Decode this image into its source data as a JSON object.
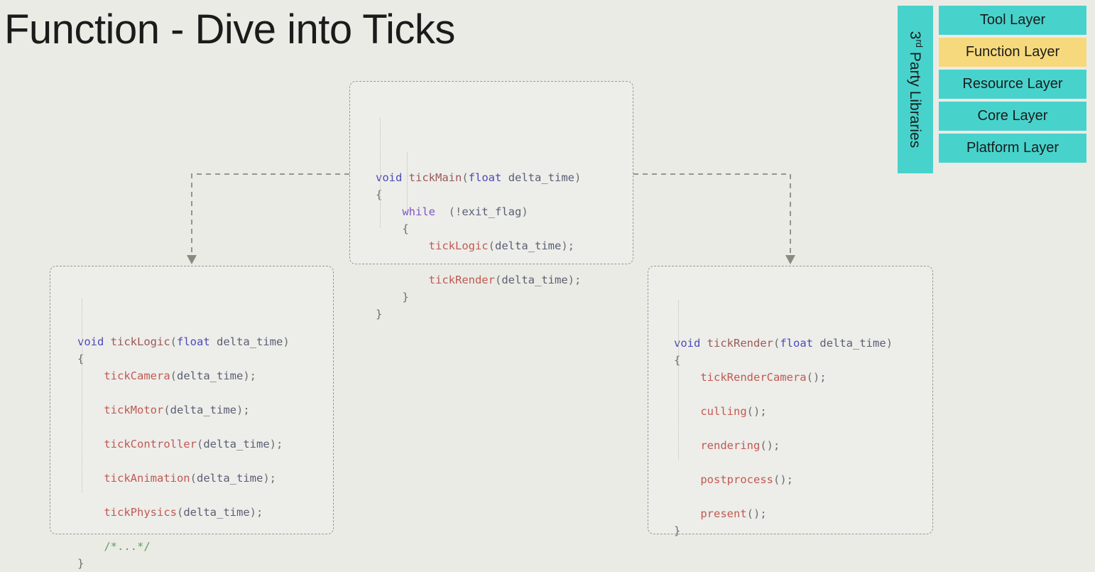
{
  "slide": {
    "title": "Function - Dive into Ticks",
    "background_color": "#ebebe6"
  },
  "layer_panel": {
    "third_party_label_main": "3",
    "third_party_label_sup": "rd",
    "third_party_label_rest": " Party Libraries",
    "teal_color": "#47d3cc",
    "highlight_color": "#f6d97c",
    "layers": [
      {
        "label": "Tool Layer",
        "highlighted": false
      },
      {
        "label": "Function Layer",
        "highlighted": true
      },
      {
        "label": "Resource Layer",
        "highlighted": false
      },
      {
        "label": "Core Layer",
        "highlighted": false
      },
      {
        "label": "Platform Layer",
        "highlighted": false
      }
    ]
  },
  "code_blocks": {
    "main": {
      "name": "tickMain",
      "signature_keyword": "void",
      "signature_name": "tickMain",
      "param_type": "float",
      "param_name": "delta_time",
      "lines": [
        {
          "tokens": [
            {
              "t": "kw",
              "v": "void"
            },
            {
              "t": "plain",
              "v": " "
            },
            {
              "t": "fndef",
              "v": "tickMain"
            },
            {
              "t": "punct",
              "v": "("
            },
            {
              "t": "kw",
              "v": "float"
            },
            {
              "t": "plain",
              "v": " "
            },
            {
              "t": "var",
              "v": "delta_time"
            },
            {
              "t": "punct",
              "v": ")"
            }
          ]
        },
        {
          "tokens": [
            {
              "t": "punct",
              "v": "{"
            }
          ]
        },
        {
          "tokens": [
            {
              "t": "plain",
              "v": "    "
            },
            {
              "t": "ctrl",
              "v": "while"
            },
            {
              "t": "plain",
              "v": "  "
            },
            {
              "t": "punct",
              "v": "(!"
            },
            {
              "t": "var",
              "v": "exit_flag"
            },
            {
              "t": "punct",
              "v": ")"
            }
          ]
        },
        {
          "tokens": [
            {
              "t": "plain",
              "v": "    "
            },
            {
              "t": "punct",
              "v": "{"
            }
          ]
        },
        {
          "tokens": [
            {
              "t": "plain",
              "v": "        "
            },
            {
              "t": "call",
              "v": "tickLogic"
            },
            {
              "t": "punct",
              "v": "("
            },
            {
              "t": "var",
              "v": "delta_time"
            },
            {
              "t": "punct",
              "v": ");"
            }
          ]
        },
        {
          "tokens": []
        },
        {
          "tokens": [
            {
              "t": "plain",
              "v": "        "
            },
            {
              "t": "call",
              "v": "tickRender"
            },
            {
              "t": "punct",
              "v": "("
            },
            {
              "t": "var",
              "v": "delta_time"
            },
            {
              "t": "punct",
              "v": ");"
            }
          ]
        },
        {
          "tokens": [
            {
              "t": "plain",
              "v": "    "
            },
            {
              "t": "punct",
              "v": "}"
            }
          ]
        },
        {
          "tokens": [
            {
              "t": "punct",
              "v": "}"
            }
          ]
        }
      ]
    },
    "logic": {
      "name": "tickLogic",
      "lines": [
        {
          "tokens": [
            {
              "t": "kw",
              "v": "void"
            },
            {
              "t": "plain",
              "v": " "
            },
            {
              "t": "fndef",
              "v": "tickLogic"
            },
            {
              "t": "punct",
              "v": "("
            },
            {
              "t": "kw",
              "v": "float"
            },
            {
              "t": "plain",
              "v": " "
            },
            {
              "t": "var",
              "v": "delta_time"
            },
            {
              "t": "punct",
              "v": ")"
            }
          ]
        },
        {
          "tokens": [
            {
              "t": "punct",
              "v": "{"
            }
          ]
        },
        {
          "tokens": [
            {
              "t": "plain",
              "v": "    "
            },
            {
              "t": "call",
              "v": "tickCamera"
            },
            {
              "t": "punct",
              "v": "("
            },
            {
              "t": "var",
              "v": "delta_time"
            },
            {
              "t": "punct",
              "v": ");"
            }
          ]
        },
        {
          "tokens": []
        },
        {
          "tokens": [
            {
              "t": "plain",
              "v": "    "
            },
            {
              "t": "call",
              "v": "tickMotor"
            },
            {
              "t": "punct",
              "v": "("
            },
            {
              "t": "var",
              "v": "delta_time"
            },
            {
              "t": "punct",
              "v": ");"
            }
          ]
        },
        {
          "tokens": []
        },
        {
          "tokens": [
            {
              "t": "plain",
              "v": "    "
            },
            {
              "t": "call",
              "v": "tickController"
            },
            {
              "t": "punct",
              "v": "("
            },
            {
              "t": "var",
              "v": "delta_time"
            },
            {
              "t": "punct",
              "v": ");"
            }
          ]
        },
        {
          "tokens": []
        },
        {
          "tokens": [
            {
              "t": "plain",
              "v": "    "
            },
            {
              "t": "call",
              "v": "tickAnimation"
            },
            {
              "t": "punct",
              "v": "("
            },
            {
              "t": "var",
              "v": "delta_time"
            },
            {
              "t": "punct",
              "v": ");"
            }
          ]
        },
        {
          "tokens": []
        },
        {
          "tokens": [
            {
              "t": "plain",
              "v": "    "
            },
            {
              "t": "call",
              "v": "tickPhysics"
            },
            {
              "t": "punct",
              "v": "("
            },
            {
              "t": "var",
              "v": "delta_time"
            },
            {
              "t": "punct",
              "v": ");"
            }
          ]
        },
        {
          "tokens": []
        },
        {
          "tokens": [
            {
              "t": "plain",
              "v": "    "
            },
            {
              "t": "cmt",
              "v": "/*...*/"
            }
          ]
        },
        {
          "tokens": [
            {
              "t": "punct",
              "v": "}"
            }
          ]
        }
      ]
    },
    "render": {
      "name": "tickRender",
      "lines": [
        {
          "tokens": [
            {
              "t": "kw",
              "v": "void"
            },
            {
              "t": "plain",
              "v": " "
            },
            {
              "t": "fndef",
              "v": "tickRender"
            },
            {
              "t": "punct",
              "v": "("
            },
            {
              "t": "kw",
              "v": "float"
            },
            {
              "t": "plain",
              "v": " "
            },
            {
              "t": "var",
              "v": "delta_time"
            },
            {
              "t": "punct",
              "v": ")"
            }
          ]
        },
        {
          "tokens": [
            {
              "t": "punct",
              "v": "{"
            }
          ]
        },
        {
          "tokens": [
            {
              "t": "plain",
              "v": "    "
            },
            {
              "t": "call",
              "v": "tickRenderCamera"
            },
            {
              "t": "punct",
              "v": "();"
            }
          ]
        },
        {
          "tokens": []
        },
        {
          "tokens": [
            {
              "t": "plain",
              "v": "    "
            },
            {
              "t": "call",
              "v": "culling"
            },
            {
              "t": "punct",
              "v": "();"
            }
          ]
        },
        {
          "tokens": []
        },
        {
          "tokens": [
            {
              "t": "plain",
              "v": "    "
            },
            {
              "t": "call",
              "v": "rendering"
            },
            {
              "t": "punct",
              "v": "();"
            }
          ]
        },
        {
          "tokens": []
        },
        {
          "tokens": [
            {
              "t": "plain",
              "v": "    "
            },
            {
              "t": "call",
              "v": "postprocess"
            },
            {
              "t": "punct",
              "v": "();"
            }
          ]
        },
        {
          "tokens": []
        },
        {
          "tokens": [
            {
              "t": "plain",
              "v": "    "
            },
            {
              "t": "call",
              "v": "present"
            },
            {
              "t": "punct",
              "v": "();"
            }
          ]
        },
        {
          "tokens": [
            {
              "t": "punct",
              "v": "}"
            }
          ]
        }
      ]
    }
  },
  "connectors": {
    "line_color": "#8a8a83",
    "edges": [
      {
        "from": "tickMain",
        "to": "tickLogic"
      },
      {
        "from": "tickMain",
        "to": "tickRender"
      }
    ]
  }
}
